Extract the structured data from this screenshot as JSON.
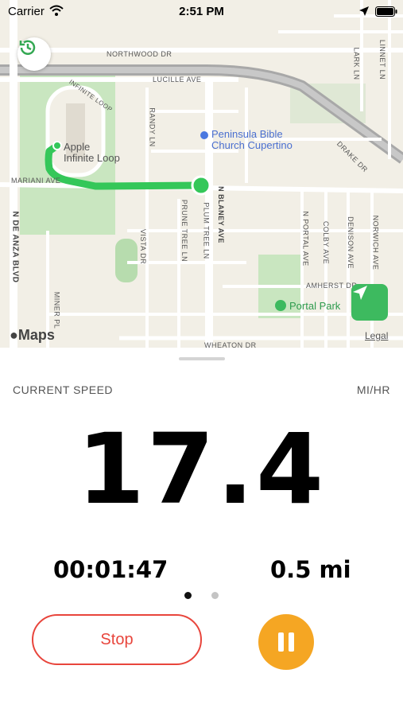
{
  "status_bar": {
    "carrier": "Carrier",
    "time": "2:51 PM",
    "wifi_icon": "wifi-icon",
    "location_icon": "location-arrow-icon",
    "battery_icon": "battery-icon"
  },
  "map": {
    "pois": [
      {
        "name": "Apple Infinite Loop",
        "line1": "Apple",
        "line2": "Infinite Loop"
      },
      {
        "name": "Peninsula Bible Church Cupertino",
        "line1": "Peninsula Bible",
        "line2": "Church Cupertino"
      },
      {
        "name": "Portal Park",
        "line1": "Portal Park"
      }
    ],
    "streets": {
      "northwood": "NORTHWOOD DR",
      "lucille": "LUCILLE AVE",
      "infinite": "INFINITE LOOP",
      "randy": "RANDY LN",
      "drake": "DRAKE DR",
      "mariani": "MARIANI AVE",
      "de_anza": "N DE ANZA BLVD",
      "vista": "VISTA DR",
      "prune": "PRUNE TREE LN",
      "plum": "PLUM TREE LN",
      "blaney": "N BLANEY AVE",
      "portal": "N PORTAL AVE",
      "colby": "COLBY AVE",
      "denison": "DENISON AVE",
      "norwich": "NORWICH AVE",
      "amherst": "AMHERST DR",
      "miner": "MINER PL",
      "wheaton": "WHEATON DR",
      "linnet": "LINNET LN",
      "lark": "LARK LN"
    },
    "maps_logo": "Maps",
    "legal": "Legal",
    "route_color": "#34c759",
    "history_icon": "history-icon",
    "navigate_icon": "navigation-arrow-icon"
  },
  "stats": {
    "speed_label": "CURRENT SPEED",
    "unit_label": "MI/HR",
    "speed_value": "17.4",
    "elapsed_time": "00:01:47",
    "distance": "0.5 mi",
    "page_count": 2,
    "active_page": 1
  },
  "controls": {
    "stop_label": "Stop",
    "pause_icon": "pause-icon",
    "stop_color": "#e8453c",
    "pause_color": "#f5a623"
  }
}
